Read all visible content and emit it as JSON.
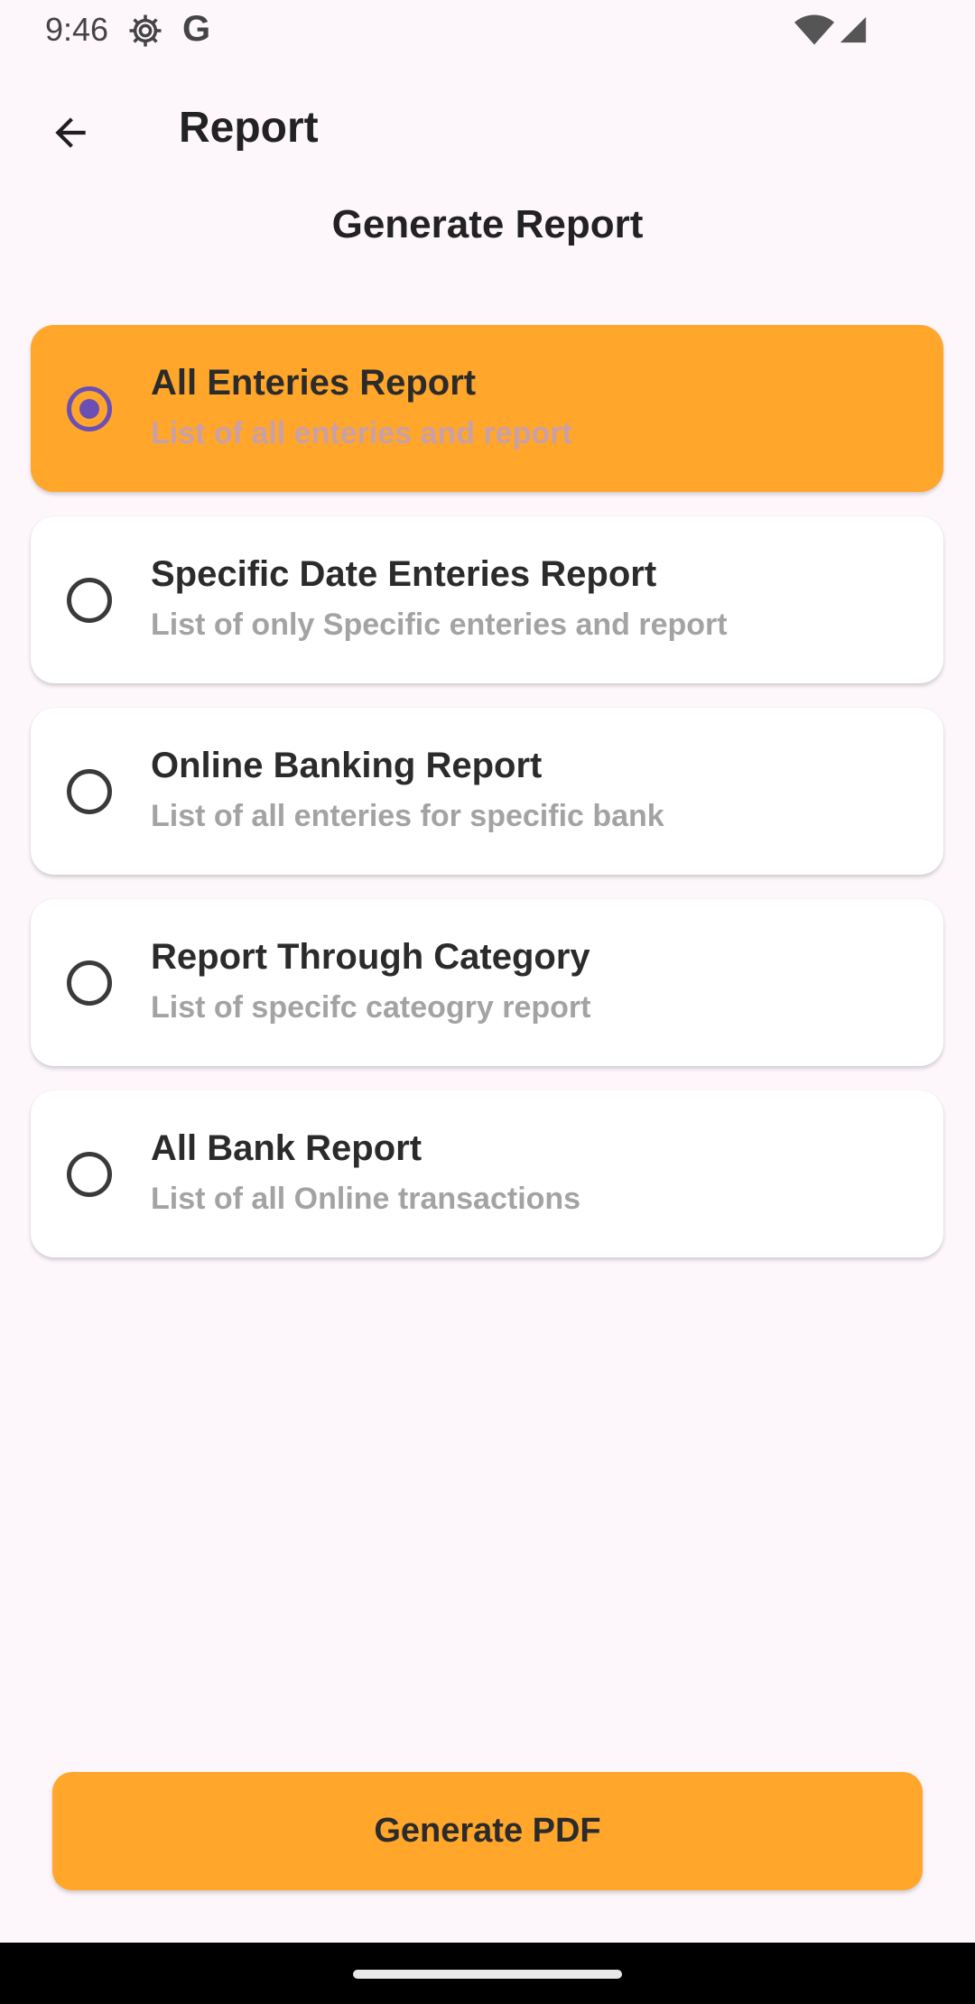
{
  "status_bar": {
    "time": "9:46",
    "g_label": "G",
    "icons": [
      "gear-icon",
      "google-icon",
      "wifi-icon",
      "signal-icon"
    ]
  },
  "app_bar": {
    "title": "Report",
    "back_icon": "arrow-back-icon"
  },
  "section_title": "Generate Report",
  "options": [
    {
      "title": "All Enteries Report",
      "subtitle": "List of all enteries and report",
      "selected": true
    },
    {
      "title": "Specific Date Enteries Report",
      "subtitle": "List of only Specific enteries and report",
      "selected": false
    },
    {
      "title": "Online Banking Report",
      "subtitle": "List of all enteries for specific bank",
      "selected": false
    },
    {
      "title": "Report Through Category",
      "subtitle": "List of specifc cateogry report",
      "selected": false
    },
    {
      "title": "All Bank Report",
      "subtitle": "List of all Online transactions",
      "selected": false
    }
  ],
  "generate_button": {
    "label": "Generate PDF"
  },
  "colors": {
    "background": "#fdf6fb",
    "accent": "#ffa62b",
    "radio_selected": "#6a4fb5",
    "card": "#ffffff",
    "subtitle_text": "#a3a3a3"
  }
}
